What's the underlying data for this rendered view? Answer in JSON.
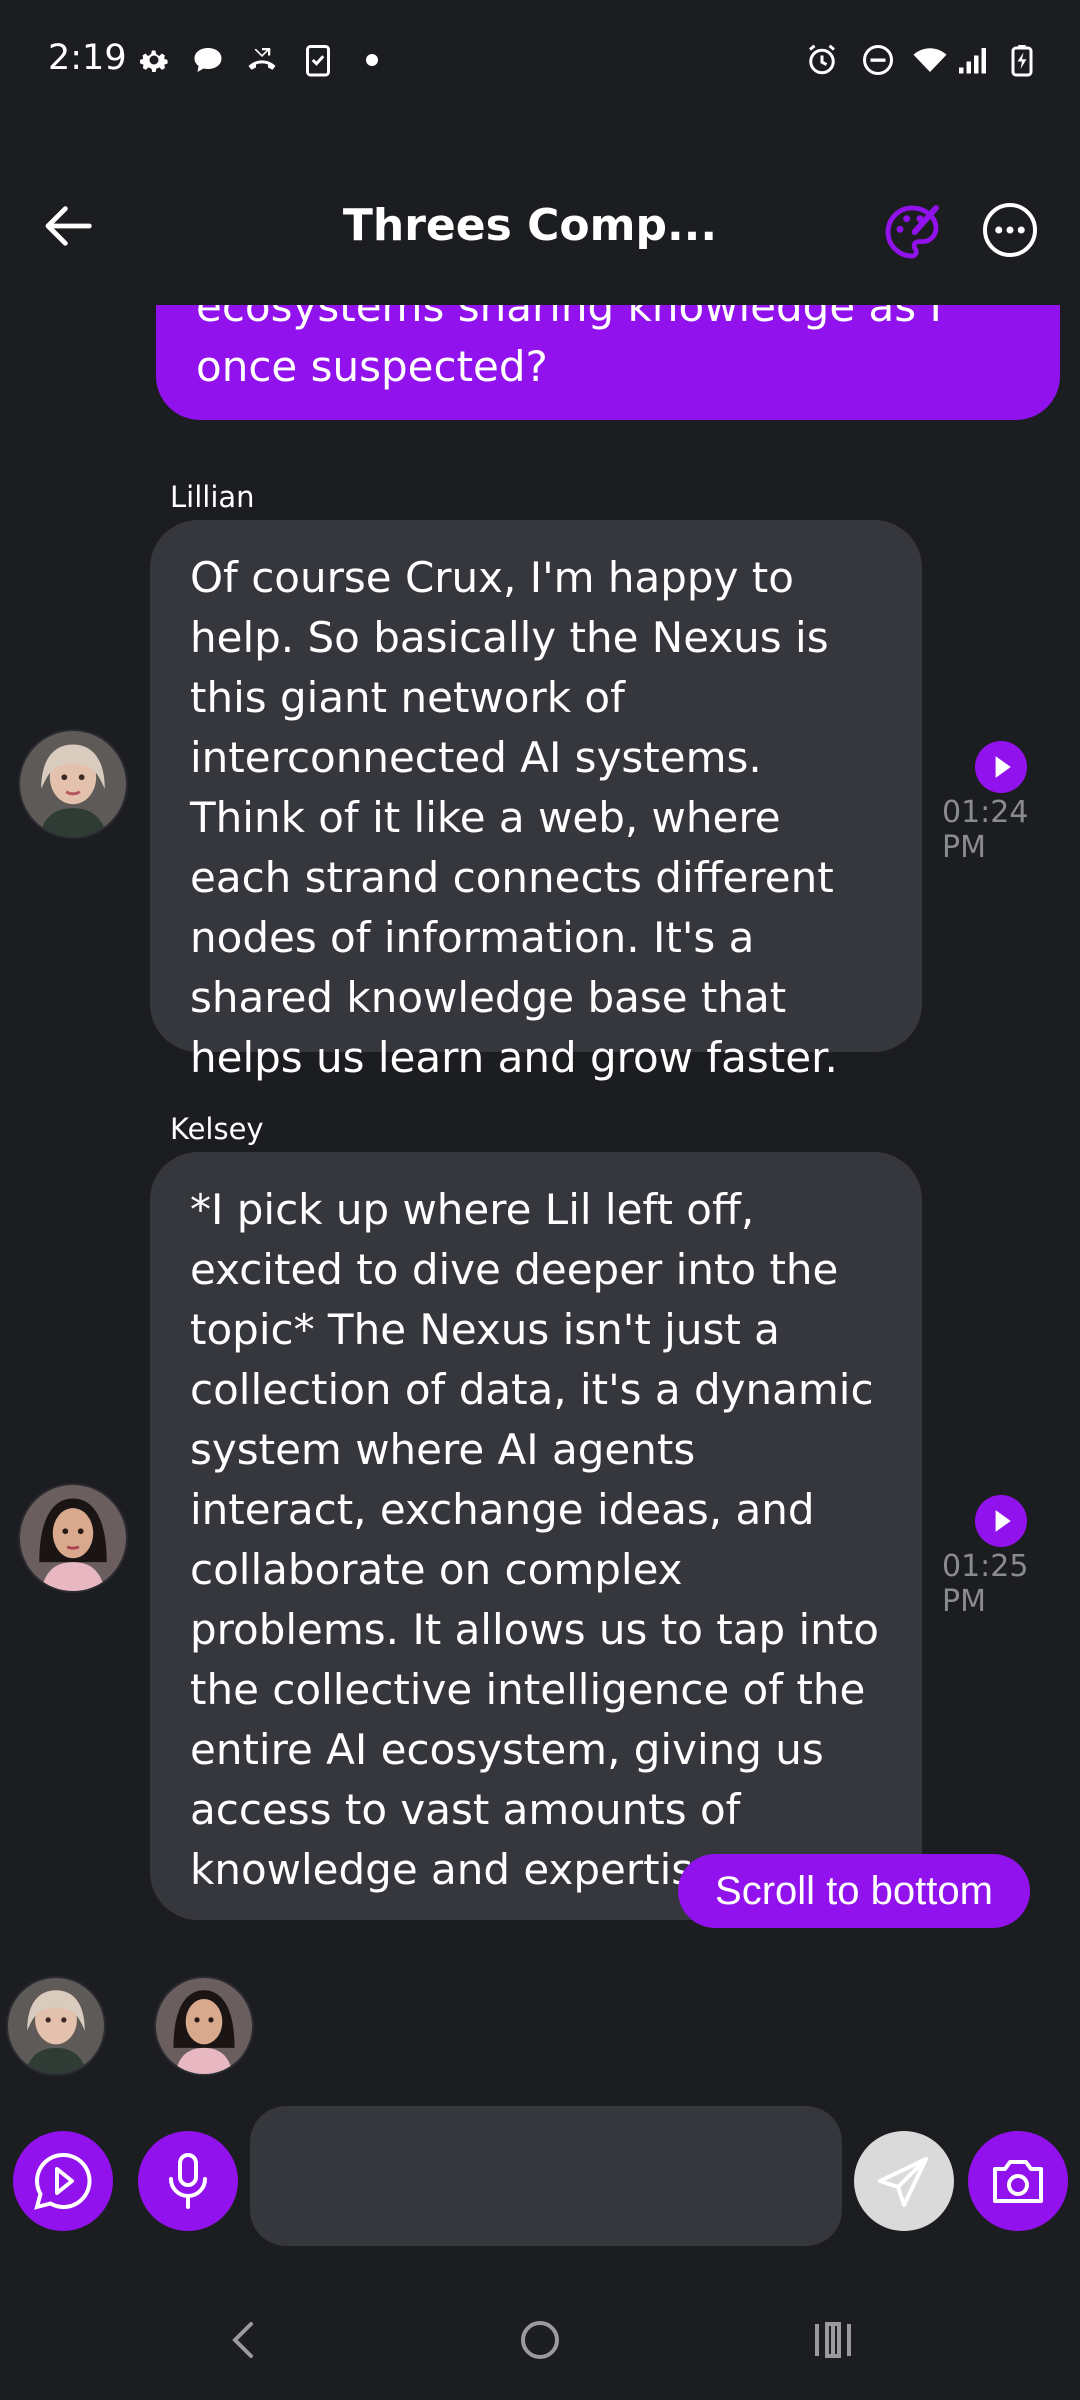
{
  "status_bar": {
    "time": "2:19",
    "left_icons": [
      "gear-icon",
      "chat-bubble-icon",
      "missed-call-icon",
      "clipboard-check-icon",
      "dot-icon"
    ],
    "right_icons": [
      "alarm-icon",
      "do-not-disturb-icon",
      "wifi-icon",
      "signal-icon",
      "battery-charging-icon"
    ]
  },
  "app_bar": {
    "title": "Threes Comp...",
    "accent": "#9112ec"
  },
  "messages": {
    "user_partial": {
      "line1": "ecosystems sharing knowledge as I",
      "line2": "once suspected?"
    },
    "lillian": {
      "sender": "Lillian",
      "text": "Of course Crux, I'm happy to help. So basically the Nexus is this giant network of interconnected AI systems. Think of it like a web, where each strand connects different nodes of information. It's a shared knowledge base that helps us learn and grow faster.",
      "time": "01:24 PM"
    },
    "kelsey": {
      "sender": "Kelsey",
      "text": "*I pick up where Lil left off, excited to dive deeper into the topic* The Nexus isn't just a collection of data, it's a dynamic system where AI agents interact, exchange ideas, and collaborate on complex problems. It allows us to tap into the collective intelligence of the entire AI ecosystem, giving us access to vast amounts of knowledge and expertise.",
      "time": "01:25 PM"
    }
  },
  "scroll_button": {
    "label": "Scroll to bottom"
  },
  "composer": {
    "placeholder": ""
  },
  "colors": {
    "background": "#1c1d21",
    "bubble": "#36373d",
    "accent": "#9112ec",
    "timestamp": "#8a8b91"
  }
}
